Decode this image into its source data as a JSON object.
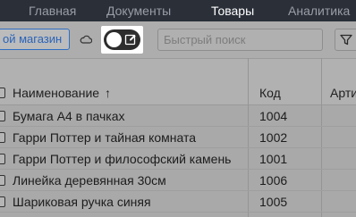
{
  "nav": {
    "tabs": [
      {
        "label": "Главная",
        "active": false
      },
      {
        "label": "Документы",
        "active": false
      },
      {
        "label": "Товары",
        "active": true
      },
      {
        "label": "Аналитика",
        "active": false
      }
    ]
  },
  "toolbar": {
    "shop_button_label": "ой магазин",
    "search_placeholder": "Быстрый поиск",
    "toggle_on": false
  },
  "table": {
    "columns": [
      {
        "label": "Наименование",
        "sort": "ascending"
      },
      {
        "label": "Код"
      },
      {
        "label": "Арти"
      }
    ],
    "sort_indicator": "↑",
    "rows": [
      {
        "name": "Бумага А4 в пачках",
        "code": "1004"
      },
      {
        "name": "Гарри Поттер и тайная комната",
        "code": "1002"
      },
      {
        "name": "Гарри Поттер и философский камень",
        "code": "1001"
      },
      {
        "name": "Линейка деревянная 30см",
        "code": "1006"
      },
      {
        "name": "Шариковая ручка синяя",
        "code": "1005"
      }
    ]
  },
  "colors": {
    "nav_bg": "#2a2f38",
    "accent": "#2f6ec3",
    "overlay_bg": "#a9a9a9"
  }
}
